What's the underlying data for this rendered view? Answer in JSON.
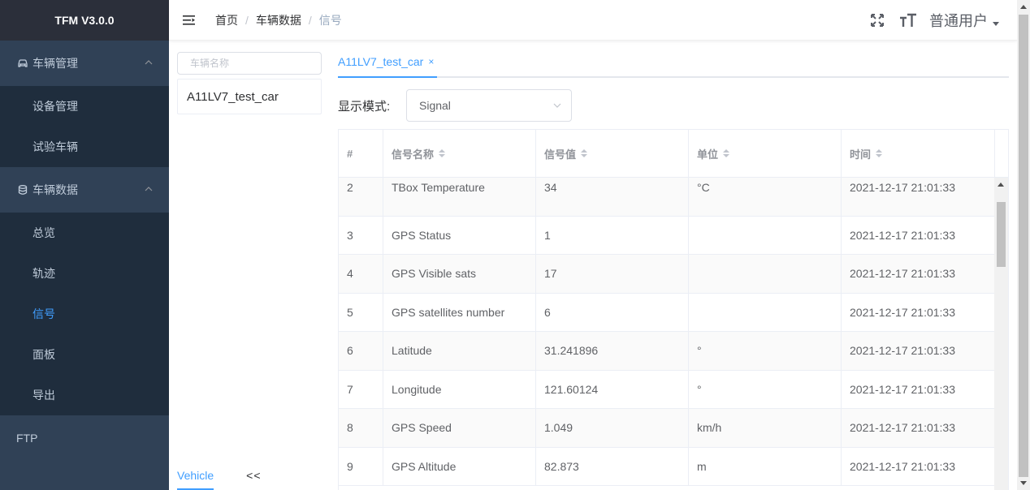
{
  "app": {
    "title": "TFM V3.0.0"
  },
  "sidebar": {
    "groups": [
      {
        "label": "车辆管理",
        "icon": "car-icon",
        "items": [
          "设备管理",
          "试验车辆"
        ]
      },
      {
        "label": "车辆数据",
        "icon": "database-icon",
        "items": [
          "总览",
          "轨迹",
          "信号",
          "面板",
          "导出"
        ]
      }
    ],
    "active_item": "信号",
    "ftp_label": "FTP"
  },
  "header": {
    "breadcrumb": [
      "首页",
      "车辆数据",
      "信号"
    ],
    "user": "普通用户",
    "icons": [
      "hamburger-icon",
      "fullscreen-icon",
      "font-size-icon"
    ]
  },
  "left_panel": {
    "search_placeholder": "车辆名称",
    "vehicles": [
      "A11LV7_test_car"
    ],
    "tabs": {
      "active": "Vehicle",
      "collapse": "<<"
    }
  },
  "main": {
    "tab_label": "A11LV7_test_car",
    "tab_close": "×",
    "mode_label": "显示模式:",
    "mode_value": "Signal",
    "table": {
      "columns": [
        "#",
        "信号名称",
        "信号值",
        "单位",
        "时间"
      ],
      "rows": [
        [
          "2",
          "TBox Temperature",
          "34",
          "°C",
          "2021-12-17 21:01:33"
        ],
        [
          "3",
          "GPS Status",
          "1",
          "",
          "2021-12-17 21:01:33"
        ],
        [
          "4",
          "GPS Visible sats",
          "17",
          "",
          "2021-12-17 21:01:33"
        ],
        [
          "5",
          "GPS satellites number",
          "6",
          "",
          "2021-12-17 21:01:33"
        ],
        [
          "6",
          "Latitude",
          "31.241896",
          "°",
          "2021-12-17 21:01:33"
        ],
        [
          "7",
          "Longitude",
          "121.60124",
          "°",
          "2021-12-17 21:01:33"
        ],
        [
          "8",
          "GPS Speed",
          "1.049",
          "km/h",
          "2021-12-17 21:01:33"
        ],
        [
          "9",
          "GPS Altitude",
          "82.873",
          "m",
          "2021-12-17 21:01:33"
        ]
      ]
    }
  },
  "colors": {
    "sidebar_bg": "#304156",
    "submenu_bg": "#1f2d3d",
    "accent": "#409eff"
  }
}
